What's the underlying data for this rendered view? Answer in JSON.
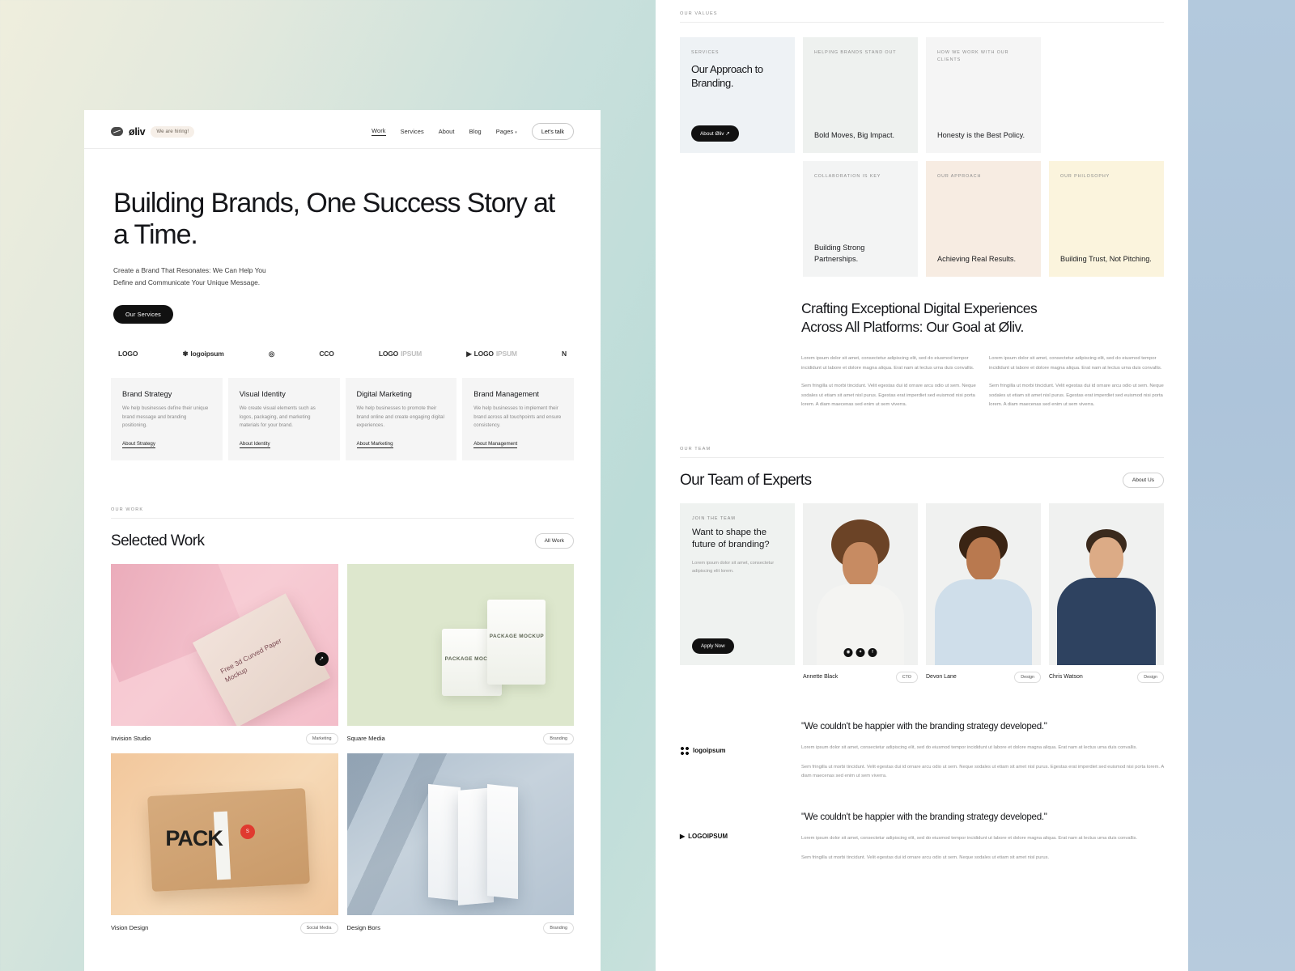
{
  "nav": {
    "logo_text": "øliv",
    "hiring_badge": "We are hiring!",
    "links": [
      {
        "label": "Work",
        "active": true
      },
      {
        "label": "Services",
        "active": false
      },
      {
        "label": "About",
        "active": false
      },
      {
        "label": "Blog",
        "active": false
      },
      {
        "label": "Pages",
        "active": false,
        "caret": "▾"
      }
    ],
    "cta": "Let's talk"
  },
  "hero": {
    "title": "Building Brands, One Success Story at a Time.",
    "subtitle_line1": "Create a Brand That Resonates: We Can Help You",
    "subtitle_line2": "Define and Communicate Your Unique Message.",
    "button": "Our Services"
  },
  "logo_strip": [
    {
      "main": "LOGO",
      "muted": ""
    },
    {
      "main": "logoipsum",
      "muted": "®"
    },
    {
      "main": "",
      "muted": ""
    },
    {
      "main": "CCO",
      "muted": ""
    },
    {
      "main": "LOGO",
      "muted": "IPSUM"
    },
    {
      "main": "LOGO",
      "muted": "IPSUM"
    },
    {
      "main": "N",
      "muted": ""
    }
  ],
  "services": [
    {
      "title": "Brand Strategy",
      "desc": "We help businesses define their unique brand message and branding positioning.",
      "link": "About Strategy"
    },
    {
      "title": "Visual Identity",
      "desc": "We create visual elements such as logos, packaging, and marketing materials for your brand.",
      "link": "About Identity"
    },
    {
      "title": "Digital Marketing",
      "desc": "We help businesses to promote their brand online and create engaging digital experiences.",
      "link": "About Marketing"
    },
    {
      "title": "Brand Management",
      "desc": "We help businesses to implement their brand across all touchpoints and ensure consistency.",
      "link": "About Management"
    }
  ],
  "work": {
    "eyebrow": "OUR WORK",
    "title": "Selected Work",
    "all_button": "All Work",
    "items": [
      {
        "name": "Invision Studio",
        "tag": "Marketing",
        "art_text": "Free 3d Curved Paper Mockup"
      },
      {
        "name": "Square Media",
        "tag": "Branding",
        "art_text": "PACKAGE MOCKUP"
      },
      {
        "name": "Vision Design",
        "tag": "Social Media",
        "art_text": "PACK"
      },
      {
        "name": "Design Bors",
        "tag": "Branding",
        "art_text": ""
      }
    ]
  },
  "values": {
    "eyebrow": "OUR VALUES",
    "cards": [
      {
        "eyebrow": "SERVICES",
        "big": "Our Approach to Branding.",
        "button": "About Øliv ↗",
        "bg": "#eef2f5"
      },
      {
        "eyebrow": "HELPING BRANDS STAND OUT",
        "bottom": "Bold Moves, Big Impact.",
        "bg": "#eef1ef"
      },
      {
        "eyebrow": "HOW WE WORK WITH OUR CLIENTS",
        "bottom": "Honesty is the Best Policy.",
        "bg": "#f5f5f5"
      },
      {
        "eyebrow": "COLLABORATION IS KEY",
        "bottom": "Building Strong Partnerships.",
        "bg": "#f3f4f4"
      },
      {
        "eyebrow": "OUR APPROACH",
        "bottom": "Achieving Real Results.",
        "bg": "#f7ece2"
      },
      {
        "eyebrow": "OUR PHILOSOPHY",
        "bottom": "Building Trust, Not Pitching.",
        "bg": "#fbf4dd"
      }
    ]
  },
  "craft": {
    "title": "Crafting Exceptional Digital Experiences Across All Platforms: Our Goal at Øliv.",
    "col1_p1": "Lorem ipsum dolor sit amet, consectetur adipiscing elit, sed do eiusmod tempor incididunt ut labore et dolore magna aliqua. Erat nam at lectus urna duis convallis.",
    "col1_p2": "Sem fringilla ut morbi tincidunt. Velit egestas dui id ornare arcu odio ut sem. Neque sodales ut etiam sit amet nisl purus. Egestas erat imperdiet sed euismod nisi porta lorem. A diam maecenas sed enim ut sem viverra.",
    "col2_p1": "Lorem ipsum dolor sit amet, consectetur adipiscing elit, sed do eiusmod tempor incididunt ut labore et dolore magna aliqua. Erat nam at lectus urna duis convallis.",
    "col2_p2": "Sem fringilla ut morbi tincidunt. Velit egestas dui id ornare arcu odio ut sem. Neque sodales ut etiam sit amet nisl purus. Egestas erat imperdiet sed euismod nisi porta lorem. A diam maecenas sed enim ut sem viverra."
  },
  "team": {
    "eyebrow": "OUR TEAM",
    "title": "Our Team of Experts",
    "about_button": "About Us",
    "join": {
      "eyebrow": "JOIN THE TEAM",
      "title": "Want to shape the future of branding?",
      "desc": "Lorem ipsum dolor sit amet, consectetur adipiscing elit lorem.",
      "button": "Apply Now"
    },
    "members": [
      {
        "name": "Annette Black",
        "role": "CTO",
        "socials": [
          "◉",
          "✦",
          "f"
        ]
      },
      {
        "name": "Devon Lane",
        "role": "Design",
        "socials": []
      },
      {
        "name": "Chris Watson",
        "role": "Design",
        "socials": []
      }
    ]
  },
  "testimonials": [
    {
      "logo": "logoipsum",
      "logo_mark": "dots",
      "quote": "\"We couldn't be happier with the branding strategy developed.\"",
      "p1": "Lorem ipsum dolor sit amet, consectetur adipiscing elit, sed do eiusmod tempor incididunt ut labore et dolore magna aliqua. Erat nam at lectus urna duis convallis.",
      "p2": "Sem fringilla ut morbi tincidunt. Velit egestas dui id ornare arcu odio ut sem. Neque sodales ut etiam sit amet nisl purus. Egestas erat imperdiet sed euismod nisi porta lorem. A diam maecenas sed enim ut sem viverra."
    },
    {
      "logo": "LOGOIPSUM",
      "logo_mark": "play",
      "quote": "\"We couldn't be happier with the branding strategy developed.\"",
      "p1": "Lorem ipsum dolor sit amet, consectetur adipiscing elit, sed do eiusmod tempor incididunt ut labore et dolore magna aliqua. Erat nam at lectus urna duis convallis.",
      "p2": "Sem fringilla ut morbi tincidunt. Velit egestas dui id ornare arcu odio ut sem. Neque sodales ut etiam sit amet nisl purus."
    }
  ]
}
